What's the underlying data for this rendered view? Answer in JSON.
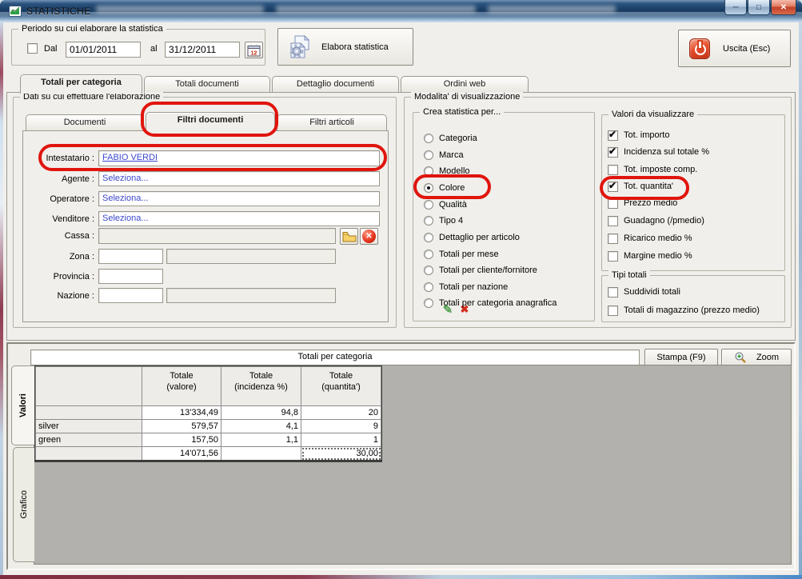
{
  "window": {
    "title": "STATISTICHE"
  },
  "icons": {
    "minimize": "─",
    "maximize": "□",
    "close": "✕",
    "check": "✔",
    "clear_x": "✖",
    "pencil": "✎"
  },
  "colors": {
    "highlight_red": "#e0150d",
    "link_blue": "#3c48cc",
    "titlebar_blue": "#173a60",
    "grid_gray": "#b2b1ad"
  },
  "period": {
    "group_label": "Periodo su cui elaborare la statistica",
    "dal_checked": false,
    "dal_label": "Dal",
    "dal_value": "01/01/2011",
    "al_label": "al",
    "al_value": "31/12/2011"
  },
  "actions": {
    "elabora_label": "Elabora statistica",
    "uscita_label": "Uscita (Esc)"
  },
  "main_tabs": {
    "items": [
      "Totali per categoria",
      "Totali documenti",
      "Dettaglio documenti",
      "Ordini web"
    ],
    "active": "Totali per categoria"
  },
  "dati": {
    "group_label": "Dati su cui effettuare l'elaborazione",
    "tabs": [
      "Documenti",
      "Filtri documenti",
      "Filtri articoli"
    ],
    "active_tab": "Filtri documenti",
    "fields": {
      "intestatario_label": "Intestatario :",
      "intestatario_value": "FABIO VERDI",
      "agente_label": "Agente :",
      "agente_value": "Seleziona...",
      "operatore_label": "Operatore :",
      "operatore_value": "Seleziona...",
      "venditore_label": "Venditore :",
      "venditore_value": "Seleziona...",
      "cassa_label": "Cassa :",
      "cassa_value": "",
      "zona_label": "Zona :",
      "zona_value": "",
      "provincia_label": "Provincia :",
      "provincia_value": "",
      "nazione_label": "Nazione :",
      "nazione_value": ""
    }
  },
  "modalita": {
    "group_label": "Modalita' di visualizzazione",
    "crea": {
      "group_label": "Crea statistica per...",
      "selected": "Colore",
      "options": [
        "Categoria",
        "Marca",
        "Modello",
        "Colore",
        "Qualità",
        "Tipo 4",
        "Dettaglio per articolo",
        "Totali per mese",
        "Totali per cliente/fornitore",
        "Totali per nazione",
        "Totali per categoria anagrafica"
      ]
    },
    "valori": {
      "group_label": "Valori da visualizzare",
      "options": [
        {
          "label": "Tot. importo",
          "checked": true
        },
        {
          "label": "Incidenza sul totale %",
          "checked": true
        },
        {
          "label": "Tot. imposte comp.",
          "checked": false
        },
        {
          "label": "Tot. quantita'",
          "checked": true
        },
        {
          "label": "Prezzo medio",
          "checked": false
        },
        {
          "label": "Guadagno (/pmedio)",
          "checked": false
        },
        {
          "label": "Ricarico medio %",
          "checked": false
        },
        {
          "label": "Margine medio %",
          "checked": false
        }
      ]
    },
    "tipi": {
      "group_label": "Tipi totali",
      "options": [
        {
          "label": "Suddividi totali",
          "checked": false
        },
        {
          "label": "Totali di magazzino (prezzo medio)",
          "checked": false
        }
      ]
    }
  },
  "results": {
    "title": "Totali per categoria",
    "stampa_label": "Stampa (F9)",
    "zoom_label": "Zoom",
    "side_tabs": [
      "Valori",
      "Grafico"
    ],
    "active_side_tab": "Valori",
    "table": {
      "columns": [
        {
          "line1": "",
          "line2": ""
        },
        {
          "line1": "Totale",
          "line2": "(valore)"
        },
        {
          "line1": "Totale",
          "line2": "(incidenza %)"
        },
        {
          "line1": "Totale",
          "line2": "(quantita')"
        }
      ],
      "rows": [
        {
          "label": "",
          "valore": "13'334,49",
          "incidenza": "94,8",
          "quantita": "20"
        },
        {
          "label": "silver",
          "valore": "579,57",
          "incidenza": "4,1",
          "quantita": "9"
        },
        {
          "label": "green",
          "valore": "157,50",
          "incidenza": "1,1",
          "quantita": "1"
        }
      ],
      "total_row": {
        "label": "",
        "valore": "14'071,56",
        "incidenza": "",
        "quantita": "30,00"
      }
    }
  }
}
